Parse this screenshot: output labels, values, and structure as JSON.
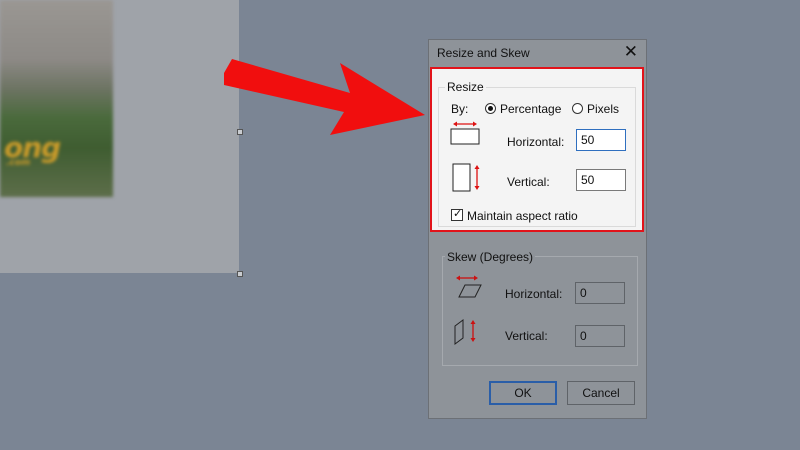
{
  "canvas": {
    "logo_text": "ong",
    "logo_sub": ".com"
  },
  "dialog": {
    "title": "Resize and Skew",
    "resize": {
      "group_label": "Resize",
      "by_label": "By:",
      "options": [
        "Percentage",
        "Pixels"
      ],
      "selected": "Percentage",
      "horizontal_label": "Horizontal:",
      "horizontal_value": "50",
      "vertical_label": "Vertical:",
      "vertical_value": "50",
      "maintain_label": "Maintain aspect ratio",
      "maintain_checked": true
    },
    "skew": {
      "group_label": "Skew (Degrees)",
      "horizontal_label": "Horizontal:",
      "horizontal_value": "0",
      "vertical_label": "Vertical:",
      "vertical_value": "0"
    },
    "ok_label": "OK",
    "cancel_label": "Cancel"
  },
  "colors": {
    "highlight": "#e2131a",
    "arrow": "#f10e0e",
    "focus": "#2f6fbf"
  }
}
